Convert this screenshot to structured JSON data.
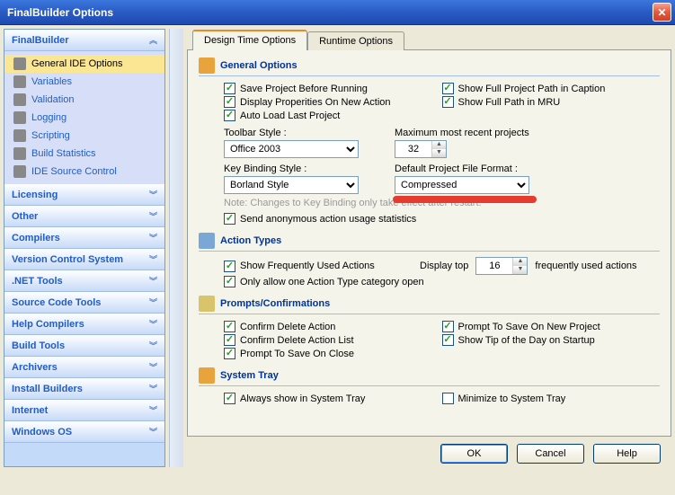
{
  "title": "FinalBuilder Options",
  "sidebar": {
    "main": {
      "label": "FinalBuilder",
      "items": [
        {
          "label": "General IDE Options"
        },
        {
          "label": "Variables"
        },
        {
          "label": "Validation"
        },
        {
          "label": "Logging"
        },
        {
          "label": "Scripting"
        },
        {
          "label": "Build Statistics"
        },
        {
          "label": "IDE Source Control"
        }
      ]
    },
    "cats": [
      "Licensing",
      "Other",
      "Compilers",
      "Version Control System",
      ".NET Tools",
      "Source Code Tools",
      "Help Compilers",
      "Build Tools",
      "Archivers",
      "Install Builders",
      "Internet",
      "Windows OS"
    ]
  },
  "tabs": {
    "design": "Design Time Options",
    "runtime": "Runtime Options"
  },
  "general": {
    "title": "General Options",
    "save_before": "Save Project Before Running",
    "show_full_caption": "Show Full Project Path in Caption",
    "display_props": "Display Properities On New Action",
    "show_full_mru": "Show Full Path in MRU",
    "auto_load": "Auto Load Last Project",
    "toolbar_label": "Toolbar Style :",
    "toolbar_value": "Office 2003",
    "max_recent_label": "Maximum most recent projects",
    "max_recent_value": "32",
    "keybind_label": "Key Binding Style :",
    "keybind_value": "Borland Style",
    "default_fmt_label": "Default Project File Format :",
    "default_fmt_value": "Compressed",
    "note": "Note: Changes to Key Binding only take effect after restart.",
    "anon_stats": "Send anonymous action usage statistics"
  },
  "action_types": {
    "title": "Action Types",
    "show_freq": "Show Frequently Used Actions",
    "display_top": "Display top",
    "display_top_value": "16",
    "freq_suffix": "frequently used actions",
    "only_one": "Only allow one Action Type category open"
  },
  "prompts": {
    "title": "Prompts/Confirmations",
    "confirm_del": "Confirm Delete Action",
    "prompt_new": "Prompt To Save On New Project",
    "confirm_del_list": "Confirm Delete Action List",
    "show_tip": "Show Tip of the Day on Startup",
    "prompt_close": "Prompt To Save On Close"
  },
  "tray": {
    "title": "System Tray",
    "always": "Always show in System Tray",
    "minimize": "Minimize to System Tray"
  },
  "buttons": {
    "ok": "OK",
    "cancel": "Cancel",
    "help": "Help"
  }
}
